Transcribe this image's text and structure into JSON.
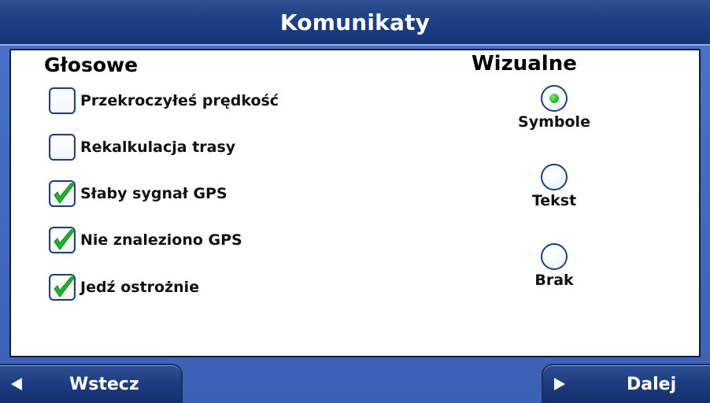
{
  "title": "Komunikaty",
  "voice": {
    "heading": "Głosowe",
    "items": [
      {
        "label": "Przekroczyłeś prędkość",
        "checked": false
      },
      {
        "label": "Rekalkulacja trasy",
        "checked": false
      },
      {
        "label": "Słaby sygnał GPS",
        "checked": true
      },
      {
        "label": "Nie znaleziono GPS",
        "checked": true
      },
      {
        "label": "Jedź ostrożnie",
        "checked": true
      }
    ]
  },
  "visual": {
    "heading": "Wizualne",
    "options": [
      {
        "label": "Symbole",
        "selected": true
      },
      {
        "label": "Tekst",
        "selected": false
      },
      {
        "label": "Brak",
        "selected": false
      }
    ]
  },
  "nav": {
    "back_label": "Wstecz",
    "next_label": "Dalej"
  },
  "colors": {
    "title_bar": "#1e3f86",
    "background": "#3a61b6",
    "check_green": "#22b12a",
    "border_navy": "#233f78"
  },
  "icons": {
    "checkmark": "checkmark-icon",
    "back_arrow": "left-arrow-icon",
    "next_arrow": "right-arrow-icon"
  }
}
